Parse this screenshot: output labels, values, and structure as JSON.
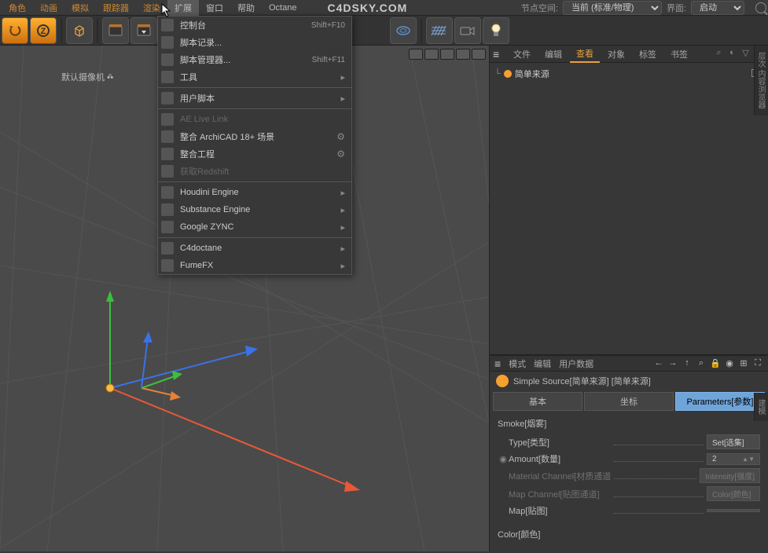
{
  "menubar": {
    "items": [
      "角色",
      "动画",
      "模拟",
      "跟踪器",
      "渲染",
      "扩展",
      "窗口",
      "帮助",
      "Octane"
    ],
    "logo": "C4DSKY.COM",
    "node_space_label": "节点空间:",
    "node_space_value": "当前 (标准/物理)",
    "layout_label": "界面:",
    "layout_value": "启动"
  },
  "dropdown": {
    "items": [
      {
        "label": "控制台",
        "shortcut": "Shift+F10"
      },
      {
        "label": "脚本记录..."
      },
      {
        "label": "脚本管理器...",
        "shortcut": "Shift+F11"
      },
      {
        "label": "工具",
        "submenu": true
      },
      {
        "sep": true
      },
      {
        "label": "用户脚本",
        "submenu": true
      },
      {
        "sep": true
      },
      {
        "label": "AE Live Link",
        "disabled": true
      },
      {
        "label": "整合 ArchiCAD 18+ 场景",
        "gear": true
      },
      {
        "label": "整合工程",
        "gear": true
      },
      {
        "label": "获取Redshift",
        "disabled": true
      },
      {
        "sep": true
      },
      {
        "label": "Houdini Engine",
        "submenu": true
      },
      {
        "label": "Substance Engine",
        "submenu": true
      },
      {
        "label": "Google ZYNC",
        "submenu": true
      },
      {
        "sep": true
      },
      {
        "label": "C4doctane",
        "submenu": true
      },
      {
        "label": "FumeFX",
        "submenu": true
      }
    ]
  },
  "viewport": {
    "camera_label": "默认摄像机"
  },
  "object_tabs": [
    "文件",
    "编辑",
    "查看",
    "对象",
    "标签",
    "书签"
  ],
  "object_tabs_active": 2,
  "object": {
    "name": "简单来源"
  },
  "attr_bar": [
    "模式",
    "编辑",
    "用户数据"
  ],
  "attr_head": "Simple Source[简单来源] [简单来源]",
  "attr_tabs": [
    {
      "label": "基本"
    },
    {
      "label": "坐标"
    },
    {
      "label": "Parameters[参数]",
      "active": true
    }
  ],
  "params": {
    "section_smoke": "Smoke[烟雾]",
    "rows": [
      {
        "label": "Type[类型]",
        "value": "Set[选集]"
      },
      {
        "label": "Amount[数量]",
        "value": "2",
        "key": true,
        "spin": true
      },
      {
        "label": "Material Channel[材质通道]",
        "value": "Intensity[强度]",
        "dim": true
      },
      {
        "label": "Map Channel[贴图通道]",
        "value": "Color[颜色]",
        "dim": true
      },
      {
        "label": "Map[贴图]",
        "value": ""
      }
    ],
    "section_color": "Color[颜色]"
  },
  "side_label_1": "层次 内容浏览器",
  "side_label_2": "建模"
}
